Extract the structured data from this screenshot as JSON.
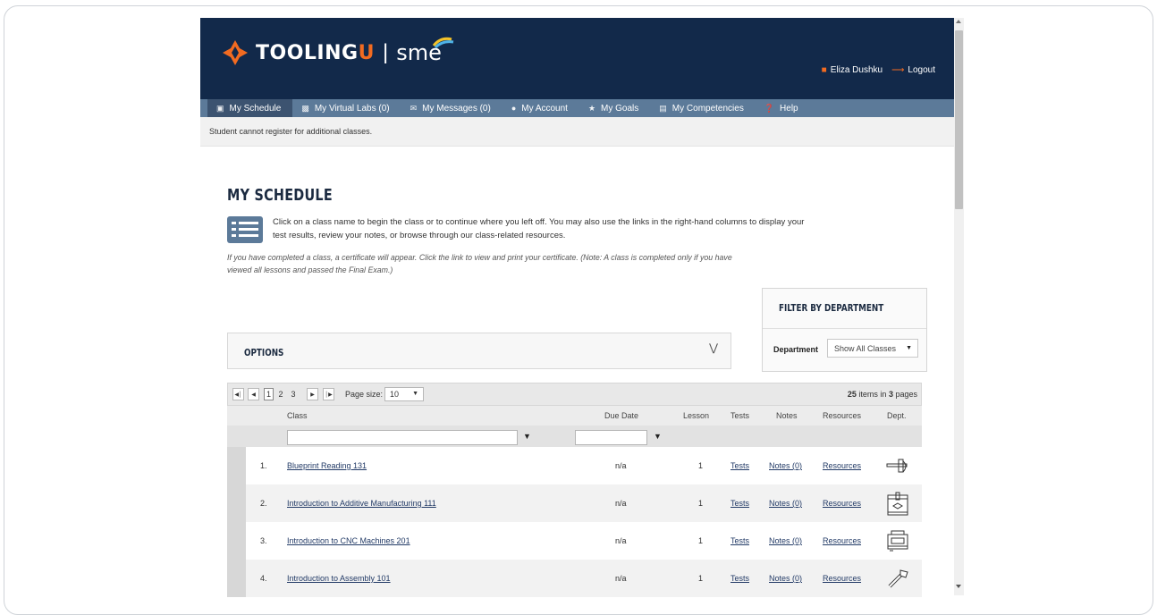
{
  "header": {
    "logo_word_a": "TOOLING",
    "logo_word_b": "U",
    "logo_sep": "|",
    "logo_sme": "sme",
    "user_name": "Eliza Dushku",
    "logout_label": "Logout"
  },
  "nav": [
    {
      "label": "My Schedule",
      "icon": "schedule-icon"
    },
    {
      "label": "My Virtual Labs (0)",
      "icon": "labs-icon"
    },
    {
      "label": "My Messages (0)",
      "icon": "messages-icon"
    },
    {
      "label": "My Account",
      "icon": "account-icon"
    },
    {
      "label": "My Goals",
      "icon": "trophy-icon"
    },
    {
      "label": "My Competencies",
      "icon": "competencies-icon"
    },
    {
      "label": "Help",
      "icon": "help-icon"
    }
  ],
  "notice": "Student cannot register for additional classes.",
  "page_title": "MY SCHEDULE",
  "intro": "Click on a class name to begin the class or to continue where you left off. You may also use the links in the right-hand columns to display your test results, review your notes, or browse through our class-related resources.",
  "note": "If you have completed a class, a certificate will appear. Click the link to view and print your certificate. (Note: A class is completed only if you have viewed all lessons and passed the Final Exam.)",
  "filter": {
    "title": "FILTER BY DEPARTMENT",
    "label": "Department",
    "selected": "Show All Classes"
  },
  "options": {
    "label": "OPTIONS"
  },
  "pager": {
    "pages": [
      "1",
      "2",
      "3"
    ],
    "current": "1",
    "page_size_label": "Page size:",
    "page_size": "10",
    "total_items": "25",
    "items_in": "items in",
    "total_pages": "3",
    "pages_word": "pages"
  },
  "columns": [
    "Class",
    "Due Date",
    "Lesson",
    "Tests",
    "Notes",
    "Resources",
    "Dept."
  ],
  "rows": [
    {
      "num": "1.",
      "class": "Blueprint Reading 131",
      "due": "n/a",
      "lesson": "1",
      "tests": "Tests",
      "notes": "Notes (0)",
      "resources": "Resources",
      "dept_icon": "caliper-icon"
    },
    {
      "num": "2.",
      "class": "Introduction to Additive Manufacturing 111",
      "due": "n/a",
      "lesson": "1",
      "tests": "Tests",
      "notes": "Notes (0)",
      "resources": "Resources",
      "dept_icon": "3d-printer-icon"
    },
    {
      "num": "3.",
      "class": "Introduction to CNC Machines 201",
      "due": "n/a",
      "lesson": "1",
      "tests": "Tests",
      "notes": "Notes (0)",
      "resources": "Resources",
      "dept_icon": "cnc-machine-icon"
    },
    {
      "num": "4.",
      "class": "Introduction to Assembly 101",
      "due": "n/a",
      "lesson": "1",
      "tests": "Tests",
      "notes": "Notes (0)",
      "resources": "Resources",
      "dept_icon": "bolt-icon"
    }
  ],
  "colors": {
    "header_bg": "#12294a",
    "nav_bg": "#5c7a99",
    "accent": "#f26b21",
    "link": "#223a66"
  }
}
